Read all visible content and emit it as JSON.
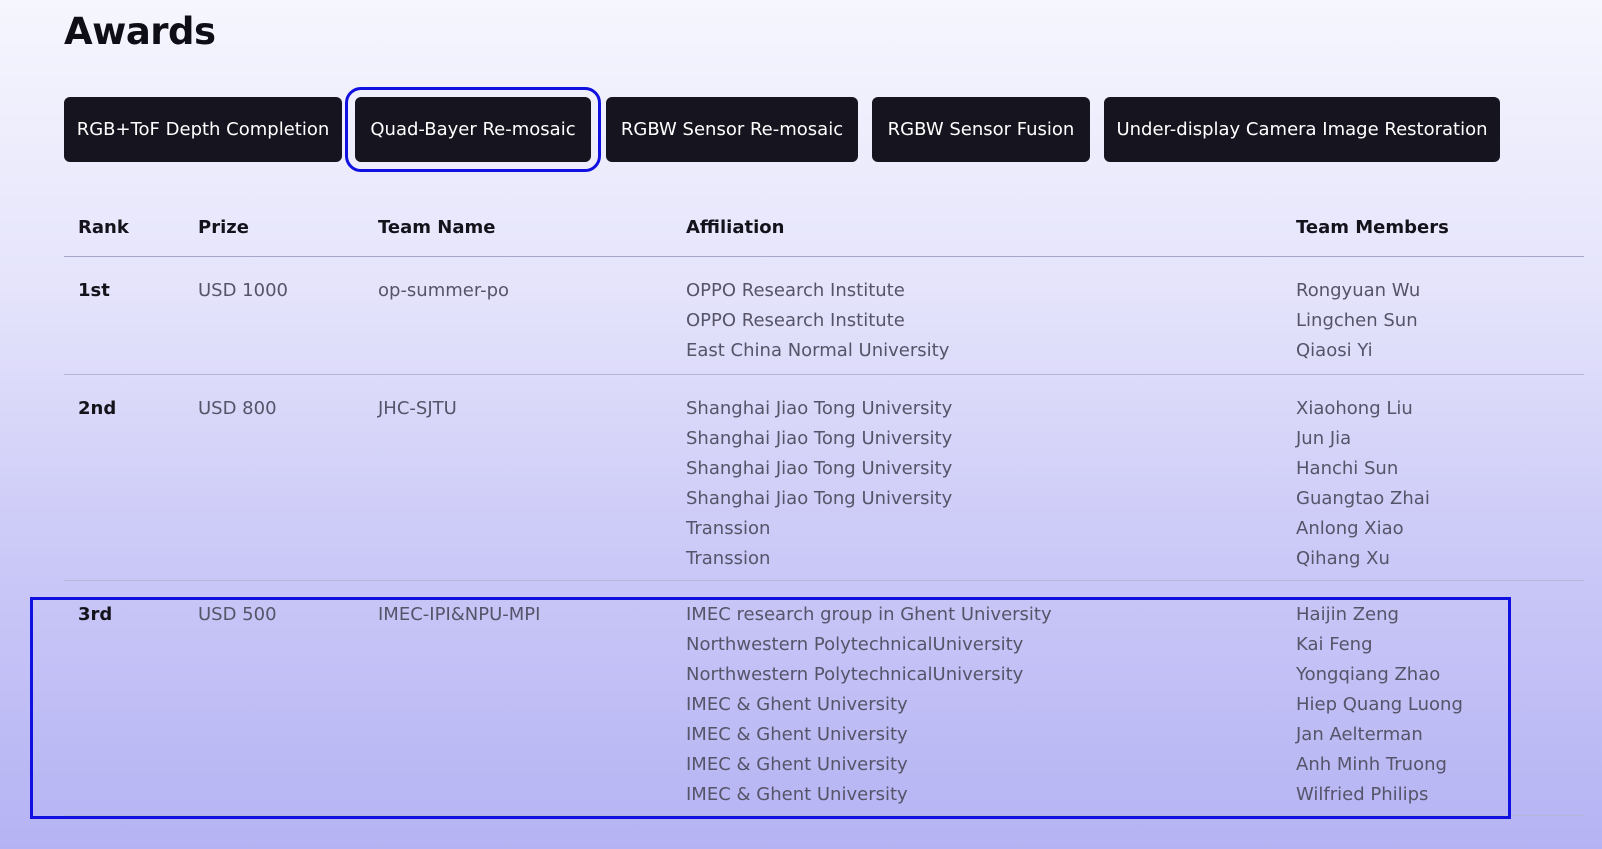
{
  "page": {
    "title": "Awards"
  },
  "tabs": [
    {
      "label": "RGB+ToF Depth Completion",
      "active": false
    },
    {
      "label": "Quad-Bayer Re-mosaic",
      "active": true
    },
    {
      "label": "RGBW Sensor Re-mosaic",
      "active": false
    },
    {
      "label": "RGBW Sensor Fusion",
      "active": false
    },
    {
      "label": "Under-display Camera Image Restoration",
      "active": false
    }
  ],
  "table": {
    "headers": {
      "rank": "Rank",
      "prize": "Prize",
      "team": "Team Name",
      "affiliation": "Affiliation",
      "members": "Team Members"
    },
    "rows": [
      {
        "rank": "1st",
        "prize": "USD 1000",
        "team": "op-summer-po",
        "affiliations": [
          "OPPO Research Institute",
          "OPPO Research Institute",
          "East China Normal University"
        ],
        "members": [
          "Rongyuan Wu",
          "Lingchen Sun",
          "Qiaosi Yi"
        ]
      },
      {
        "rank": "2nd",
        "prize": "USD 800",
        "team": "JHC-SJTU",
        "affiliations": [
          "Shanghai Jiao Tong University",
          "Shanghai Jiao Tong University",
          "Shanghai Jiao Tong University",
          "Shanghai Jiao Tong University",
          "Transsion",
          "Transsion"
        ],
        "members": [
          "Xiaohong Liu",
          "Jun Jia",
          "Hanchi Sun",
          "Guangtao Zhai",
          "Anlong Xiao",
          "Qihang Xu"
        ]
      },
      {
        "rank": "3rd",
        "prize": "USD 500",
        "team": "IMEC-IPI&NPU-MPI",
        "affiliations": [
          "IMEC research group in Ghent University",
          "Northwestern PolytechnicalUniversity",
          "Northwestern PolytechnicalUniversity",
          "IMEC & Ghent University",
          "IMEC & Ghent University",
          "IMEC & Ghent University",
          "IMEC & Ghent University"
        ],
        "members": [
          "Haijin Zeng",
          "Kai Feng",
          "Yongqiang Zhao",
          "Hiep Quang Luong",
          "Jan Aelterman",
          "Anh Minh Truong",
          "Wilfried Philips"
        ]
      }
    ]
  },
  "colors": {
    "tab_bg": "#16151f",
    "highlight": "#1010e0",
    "text_primary": "#14131c",
    "text_secondary": "#555468"
  }
}
